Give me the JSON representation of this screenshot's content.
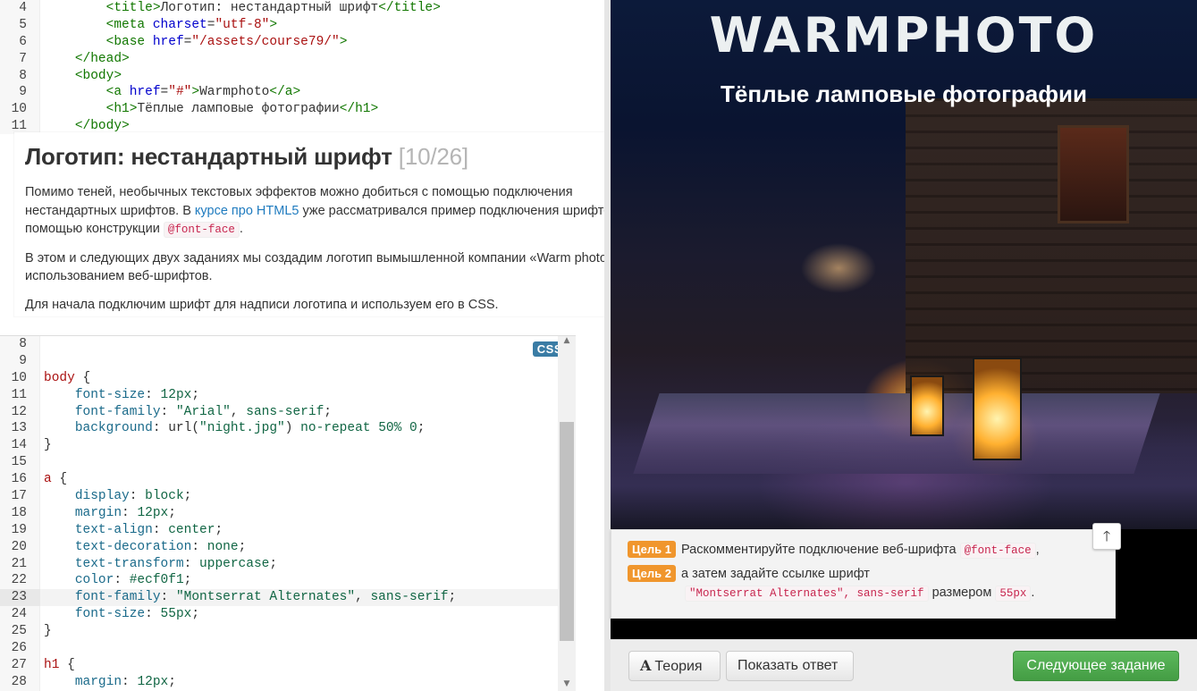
{
  "html_editor": {
    "lines": [
      {
        "n": "4",
        "html": "        <span class=\"tag\">&lt;title&gt;</span>Логотип: нестандартный шрифт<span class=\"tag\">&lt;/title&gt;</span>"
      },
      {
        "n": "5",
        "html": "        <span class=\"tag\">&lt;meta</span> <span class=\"attr\">charset</span>=<span class=\"str\">\"utf-8\"</span><span class=\"tag\">&gt;</span>"
      },
      {
        "n": "6",
        "html": "        <span class=\"tag\">&lt;base</span> <span class=\"attr\">href</span>=<span class=\"str\">\"/assets/course79/\"</span><span class=\"tag\">&gt;</span>"
      },
      {
        "n": "7",
        "html": "    <span class=\"tag\">&lt;/head&gt;</span>"
      },
      {
        "n": "8",
        "html": "    <span class=\"tag\">&lt;body&gt;</span>"
      },
      {
        "n": "9",
        "html": "        <span class=\"tag\">&lt;a</span> <span class=\"attr\">href</span>=<span class=\"str\">\"#\"</span><span class=\"tag\">&gt;</span>Warmphoto<span class=\"tag\">&lt;/a&gt;</span>"
      },
      {
        "n": "10",
        "html": "        <span class=\"tag\">&lt;h1&gt;</span>Тёплые ламповые фотографии<span class=\"tag\">&lt;/h1&gt;</span>"
      },
      {
        "n": "11",
        "html": "    <span class=\"tag\">&lt;/body&gt;</span>"
      }
    ]
  },
  "lesson": {
    "title": "Логотип: нестандартный шрифт",
    "counter": "[10/26]",
    "p1_before": "Помимо теней, необычных текстовых эффектов можно добиться с помощью подключения нестандартных шрифтов. В ",
    "p1_link": "курсе про HTML5",
    "p1_middle": " уже рассматривался пример подключения шрифтов с помощью конструкции ",
    "p1_code": "@font-face",
    "p1_end": ".",
    "p2": "В этом и следующих двух заданиях мы создадим логотип вымышленной компании «Warm photo» с использованием веб-шрифтов.",
    "p3": "Для начала подключим шрифт для надписи логотипа и используем его в CSS."
  },
  "css_editor": {
    "badge": "CSS",
    "active_line": "23",
    "lines": [
      {
        "n": "8",
        "html": ""
      },
      {
        "n": "9",
        "html": ""
      },
      {
        "n": "10",
        "html": "<span class=\"sel\">body</span> {"
      },
      {
        "n": "11",
        "html": "    <span class=\"prop\">font-size</span>: <span class=\"num\">12px</span>;"
      },
      {
        "n": "12",
        "html": "    <span class=\"prop\">font-family</span>: <span class=\"val\">\"Arial\"</span>, <span class=\"val\">sans-serif</span>;"
      },
      {
        "n": "13",
        "html": "    <span class=\"prop\">background</span>: url(<span class=\"val\">\"night.jpg\"</span>) <span class=\"val\">no-repeat</span> <span class=\"num\">50%</span> <span class=\"num\">0</span>;"
      },
      {
        "n": "14",
        "html": "}"
      },
      {
        "n": "15",
        "html": ""
      },
      {
        "n": "16",
        "html": "<span class=\"sel\">a</span> {"
      },
      {
        "n": "17",
        "html": "    <span class=\"prop\">display</span>: <span class=\"val\">block</span>;"
      },
      {
        "n": "18",
        "html": "    <span class=\"prop\">margin</span>: <span class=\"num\">12px</span>;"
      },
      {
        "n": "19",
        "html": "    <span class=\"prop\">text-align</span>: <span class=\"val\">center</span>;"
      },
      {
        "n": "20",
        "html": "    <span class=\"prop\">text-decoration</span>: <span class=\"val\">none</span>;"
      },
      {
        "n": "21",
        "html": "    <span class=\"prop\">text-transform</span>: <span class=\"val\">uppercase</span>;"
      },
      {
        "n": "22",
        "html": "    <span class=\"prop\">color</span>: <span class=\"num\">#ecf0f1</span>;"
      },
      {
        "n": "23",
        "html": "    <span class=\"prop\">font-family</span>: <span class=\"val\">\"Montserrat Alternates\"</span>, <span class=\"val\">sans-serif</span>;"
      },
      {
        "n": "24",
        "html": "    <span class=\"prop\">font-size</span>: <span class=\"num\">55px</span>;"
      },
      {
        "n": "25",
        "html": "}"
      },
      {
        "n": "26",
        "html": ""
      },
      {
        "n": "27",
        "html": "<span class=\"sel\">h1</span> {"
      },
      {
        "n": "28",
        "html": "    <span class=\"prop\">margin</span>: <span class=\"num\">12px</span>;"
      }
    ]
  },
  "preview": {
    "logo": "Warmphoto",
    "subtitle": "Тёплые ламповые фотографии"
  },
  "goals": {
    "goal1_badge": "Цель 1",
    "goal1_text": "Раскомментируйте подключение веб-шрифта",
    "goal1_code": "@font-face",
    "goal1_end": ",",
    "goal2_badge": "Цель 2",
    "goal2_text": "а затем задайте ссылке шрифт",
    "goal2_code1": "\"Montserrat Alternates\", sans-serif",
    "goal2_mid": "размером",
    "goal2_code2": "55px",
    "goal2_end": "."
  },
  "bottom": {
    "theory": "Теория",
    "show_answer": "Показать ответ",
    "next": "Следующее задание"
  },
  "colors": {
    "accent_green": "#5cb85c",
    "goal_orange": "#f0962d",
    "link_blue": "#1f7bbf",
    "logo_color": "#ecf0f1"
  }
}
